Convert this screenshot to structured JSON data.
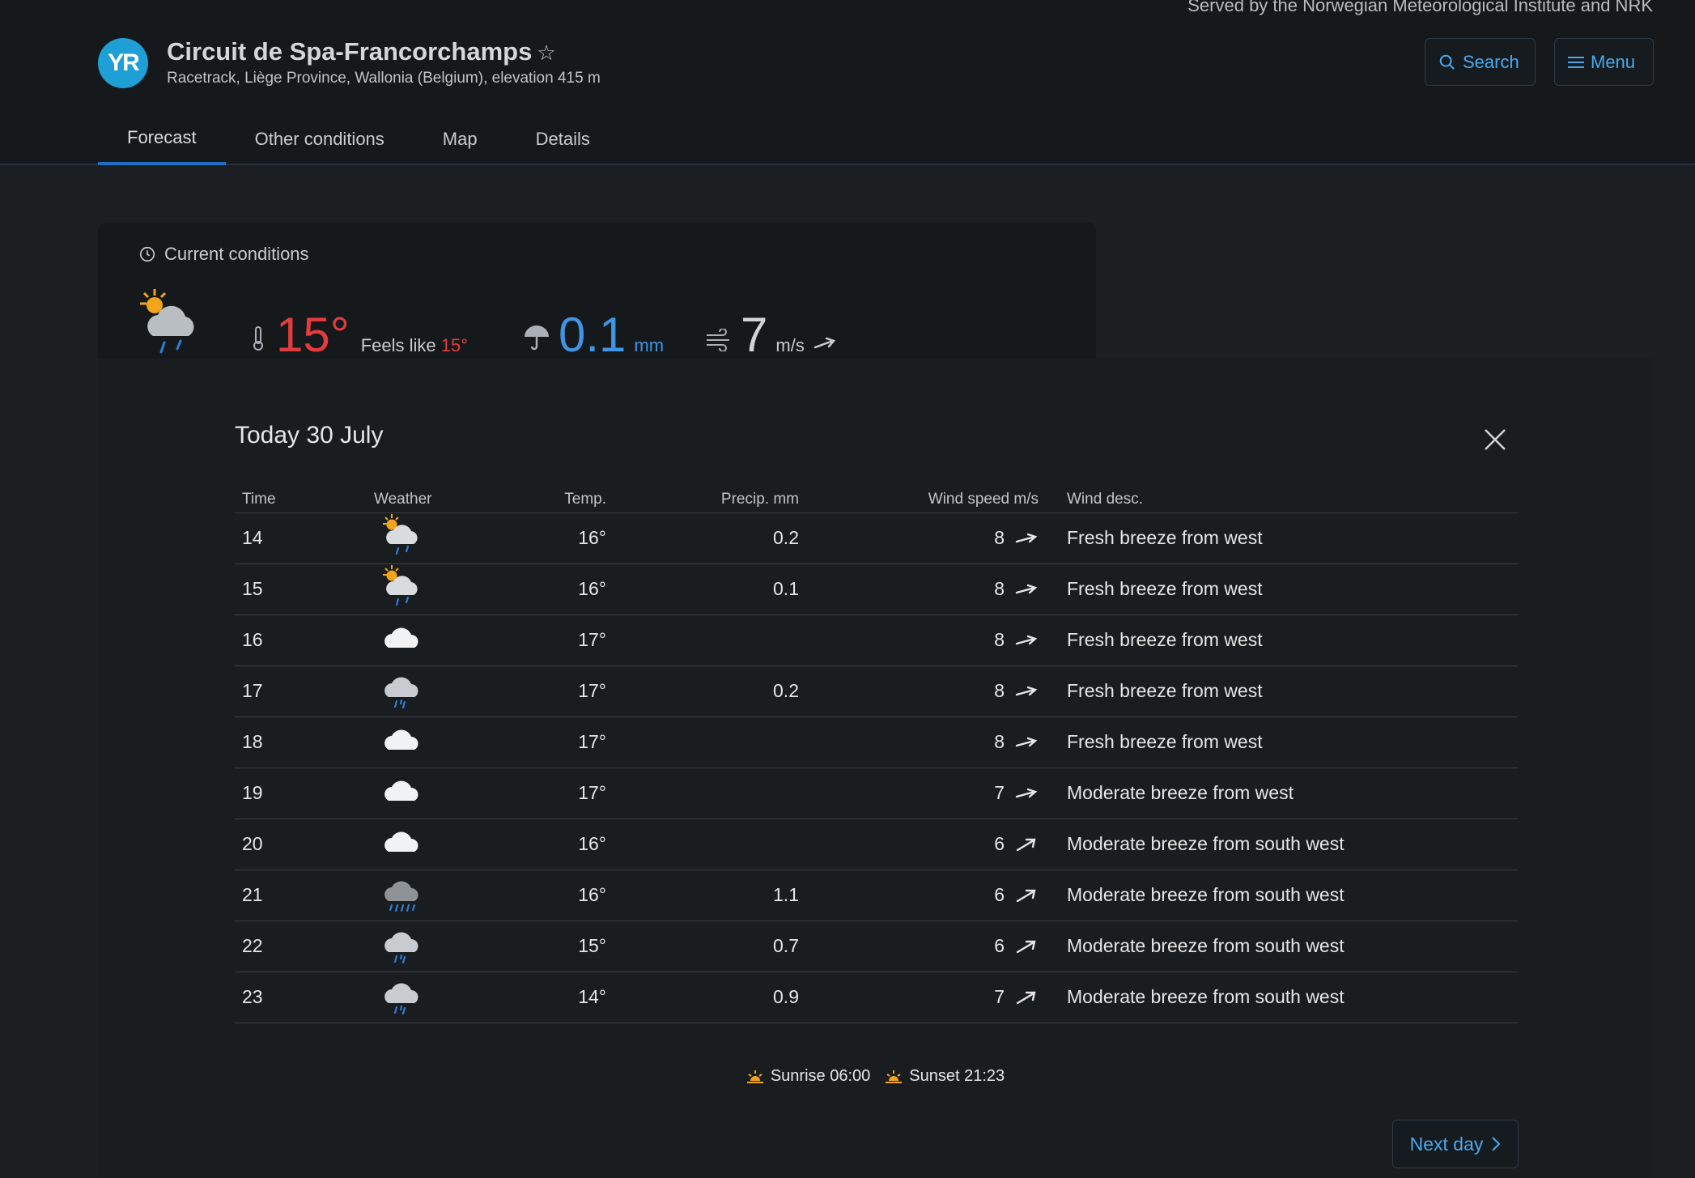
{
  "header": {
    "served_by": "Served by the Norwegian Meteorological Institute and NRK",
    "logo_text": "YR",
    "location_name": "Circuit de Spa-Francorchamps",
    "location_sub": "Racetrack, Liège Province, Wallonia (Belgium), elevation 415 m",
    "search_label": "Search",
    "menu_label": "Menu",
    "accent_color": "#4aa9ec"
  },
  "tabs": [
    {
      "label": "Forecast",
      "active": true
    },
    {
      "label": "Other conditions",
      "active": false
    },
    {
      "label": "Map",
      "active": false
    },
    {
      "label": "Details",
      "active": false
    }
  ],
  "current": {
    "title": "Current conditions",
    "icon": "partly-cloudy-light-rain-icon",
    "temp": "15°",
    "feels_like_label": "Feels like",
    "feels_like": "15°",
    "precip": "0.1",
    "precip_unit": "mm",
    "wind": "7",
    "wind_unit": "m/s"
  },
  "modal": {
    "title": "Today 30 July",
    "headers": {
      "time": "Time",
      "weather": "Weather",
      "temp": "Temp.",
      "precip": "Precip. mm",
      "wind": "Wind speed m/s",
      "wind_desc": "Wind desc."
    },
    "rows": [
      {
        "time": "14",
        "icon": "partly-cloudy-light-rain",
        "temp": "16°",
        "precip": "0.2",
        "wind": "8",
        "desc": "Fresh breeze from west",
        "dir": "w"
      },
      {
        "time": "15",
        "icon": "partly-cloudy-light-rain",
        "temp": "16°",
        "precip": "0.1",
        "wind": "8",
        "desc": "Fresh breeze from west",
        "dir": "w"
      },
      {
        "time": "16",
        "icon": "cloudy",
        "temp": "17°",
        "precip": "",
        "wind": "8",
        "desc": "Fresh breeze from west",
        "dir": "w"
      },
      {
        "time": "17",
        "icon": "light-rain",
        "temp": "17°",
        "precip": "0.2",
        "wind": "8",
        "desc": "Fresh breeze from west",
        "dir": "w"
      },
      {
        "time": "18",
        "icon": "cloudy",
        "temp": "17°",
        "precip": "",
        "wind": "8",
        "desc": "Fresh breeze from west",
        "dir": "w"
      },
      {
        "time": "19",
        "icon": "cloudy",
        "temp": "17°",
        "precip": "",
        "wind": "7",
        "desc": "Moderate breeze from west",
        "dir": "w"
      },
      {
        "time": "20",
        "icon": "cloudy",
        "temp": "16°",
        "precip": "",
        "wind": "6",
        "desc": "Moderate breeze from south west",
        "dir": "sw"
      },
      {
        "time": "21",
        "icon": "heavy-rain",
        "temp": "16°",
        "precip": "1.1",
        "wind": "6",
        "desc": "Moderate breeze from south west",
        "dir": "sw"
      },
      {
        "time": "22",
        "icon": "light-rain",
        "temp": "15°",
        "precip": "0.7",
        "wind": "6",
        "desc": "Moderate breeze from south west",
        "dir": "sw"
      },
      {
        "time": "23",
        "icon": "light-rain",
        "temp": "14°",
        "precip": "0.9",
        "wind": "7",
        "desc": "Moderate breeze from south west",
        "dir": "sw"
      }
    ],
    "sunrise": "Sunrise 06:00",
    "sunset": "Sunset 21:23",
    "next_day": "Next day"
  }
}
